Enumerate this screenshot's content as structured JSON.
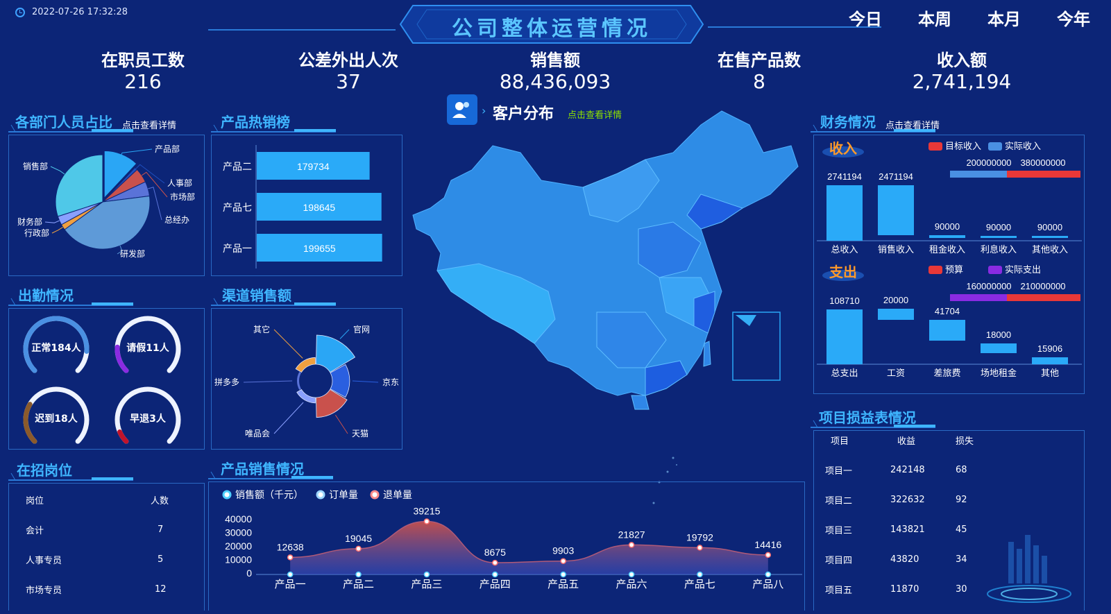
{
  "datetime": "2022-07-26 17:32:28",
  "title": "公司整体运营情况",
  "tabs": [
    "今日",
    "本周",
    "本月",
    "今年"
  ],
  "kpis": [
    {
      "label": "在职员工数",
      "value": "216"
    },
    {
      "label": "公差外出人次",
      "value": "37"
    },
    {
      "label": "销售额",
      "value": "88,436,093"
    },
    {
      "label": "在售产品数",
      "value": "8"
    },
    {
      "label": "收入额",
      "value": "2,741,194"
    }
  ],
  "dept": {
    "title": "各部门人员占比",
    "more": "点击查看详情",
    "slices": [
      {
        "name": "产品部",
        "value": 12,
        "color": "#2aa6f5"
      },
      {
        "name": "人事部",
        "value": 1,
        "color": "#1f4fbf"
      },
      {
        "name": "市场部",
        "value": 5,
        "color": "#c9514c"
      },
      {
        "name": "总经办",
        "value": 5,
        "color": "#5a73d8"
      },
      {
        "name": "研发部",
        "value": 42,
        "color": "#5e9ad8"
      },
      {
        "name": "行政部",
        "value": 2,
        "color": "#f0a040"
      },
      {
        "name": "财务部",
        "value": 3,
        "color": "#8aa0ff"
      },
      {
        "name": "销售部",
        "value": 30,
        "color": "#4fc8e8"
      }
    ]
  },
  "hot": {
    "title": "产品热销榜",
    "items": [
      {
        "name": "产品二",
        "value": 179734
      },
      {
        "name": "产品七",
        "value": 198645
      },
      {
        "name": "产品一",
        "value": 199655
      }
    ]
  },
  "attendance": {
    "title": "出勤情况",
    "items": [
      {
        "label": "正常184人",
        "ratio": 0.85,
        "color": "#4a90e2"
      },
      {
        "label": "请假11人",
        "ratio": 0.18,
        "color": "#8a2be2"
      },
      {
        "label": "迟到18人",
        "ratio": 0.28,
        "color": "#8b5a2b"
      },
      {
        "label": "早退3人",
        "ratio": 0.08,
        "color": "#c0142c"
      }
    ]
  },
  "channel": {
    "title": "渠道销售额",
    "slices": [
      {
        "name": "官网",
        "value": 40,
        "color": "#2aa6f5"
      },
      {
        "name": "京东",
        "value": 22,
        "color": "#2a5fe0"
      },
      {
        "name": "天猫",
        "value": 26,
        "color": "#c9514c"
      },
      {
        "name": "唯品会",
        "value": 4,
        "color": "#8aa0ff"
      },
      {
        "name": "拼多多",
        "value": 2,
        "color": "#0c2577"
      },
      {
        "name": "其它",
        "value": 6,
        "color": "#f0a040"
      }
    ]
  },
  "jobs": {
    "title": "在招岗位",
    "headers": [
      "岗位",
      "人数"
    ],
    "rows": [
      [
        "会计",
        "7"
      ],
      [
        "人事专员",
        "5"
      ],
      [
        "市场专员",
        "12"
      ]
    ]
  },
  "customers": {
    "title": "客户分布",
    "more": "点击查看详情"
  },
  "sales": {
    "title": "产品销售情况",
    "legend": [
      "销售额（千元）",
      "订单量",
      "退单量"
    ],
    "chart_data": {
      "type": "area",
      "categories": [
        "产品一",
        "产品二",
        "产品三",
        "产品四",
        "产品五",
        "产品六",
        "产品七",
        "产品八"
      ],
      "series": [
        {
          "name": "销售额（千元）",
          "values": [
            12638,
            19045,
            39215,
            8675,
            9903,
            21827,
            19792,
            14416
          ]
        },
        {
          "name": "订单量",
          "values": [
            0,
            0,
            0,
            0,
            0,
            0,
            0,
            0
          ]
        }
      ],
      "yticks": [
        "40000",
        "30000",
        "20000",
        "10000",
        "0"
      ],
      "ylim": [
        0,
        40000
      ]
    }
  },
  "finance": {
    "title": "财务情况",
    "more": "点击查看详情",
    "income": {
      "label": "收入",
      "legend": [
        "目标收入",
        "实际收入"
      ],
      "bar_top": [
        "200000000",
        "380000000"
      ],
      "categories": [
        "总收入",
        "销售收入",
        "租金收入",
        "利息收入",
        "其他收入"
      ],
      "values": [
        2741194,
        2471194,
        90000,
        90000,
        90000
      ],
      "labels": [
        "2741194",
        "2471194",
        "90000",
        "90000",
        "90000"
      ]
    },
    "expense": {
      "label": "支出",
      "legend": [
        "预算",
        "实际支出"
      ],
      "bar_top": [
        "160000000",
        "210000000"
      ],
      "categories": [
        "总支出",
        "工资",
        "差旅费",
        "场地租金",
        "其他"
      ],
      "labels": [
        "108710",
        "20000",
        "41704",
        "18000",
        "15906"
      ]
    }
  },
  "projects": {
    "title": "项目损益表情况",
    "headers": [
      "项目",
      "收益",
      "损失"
    ],
    "rows": [
      [
        "项目一",
        "242148",
        "68"
      ],
      [
        "项目二",
        "322632",
        "92"
      ],
      [
        "项目三",
        "143821",
        "45"
      ],
      [
        "项目四",
        "43820",
        "34"
      ],
      [
        "项目五",
        "11870",
        "30"
      ]
    ]
  }
}
